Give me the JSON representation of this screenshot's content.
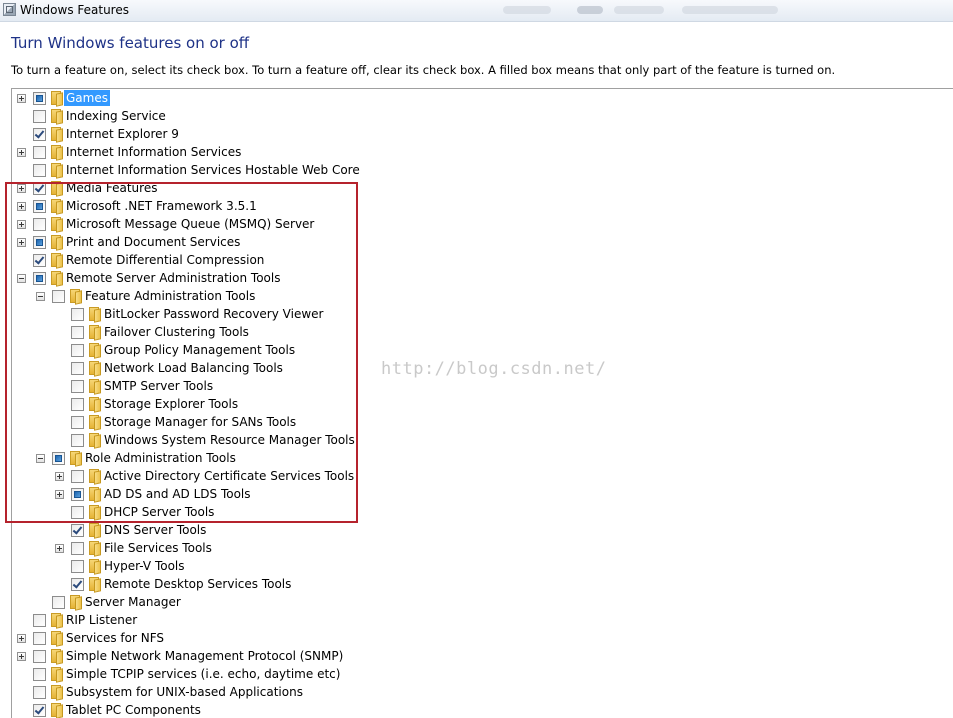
{
  "window": {
    "title": "Windows Features"
  },
  "header": {
    "title": "Turn Windows features on or off",
    "instructions": "To turn a feature on, select its check box. To turn a feature off, clear its check box. A filled box means that only part of the feature is turned on."
  },
  "watermark": "http://blog.csdn.net/",
  "tree": [
    {
      "label": "Games",
      "level": 0,
      "expander": "collapsed",
      "check": "partial",
      "selected": true
    },
    {
      "label": "Indexing Service",
      "level": 0,
      "expander": "none",
      "check": "unchecked"
    },
    {
      "label": "Internet Explorer 9",
      "level": 0,
      "expander": "none",
      "check": "checked"
    },
    {
      "label": "Internet Information Services",
      "level": 0,
      "expander": "collapsed",
      "check": "unchecked"
    },
    {
      "label": "Internet Information Services Hostable Web Core",
      "level": 0,
      "expander": "none",
      "check": "unchecked"
    },
    {
      "label": "Media Features",
      "level": 0,
      "expander": "collapsed",
      "check": "checked"
    },
    {
      "label": "Microsoft .NET Framework 3.5.1",
      "level": 0,
      "expander": "collapsed",
      "check": "partial"
    },
    {
      "label": "Microsoft Message Queue (MSMQ) Server",
      "level": 0,
      "expander": "collapsed",
      "check": "unchecked"
    },
    {
      "label": "Print and Document Services",
      "level": 0,
      "expander": "collapsed",
      "check": "partial"
    },
    {
      "label": "Remote Differential Compression",
      "level": 0,
      "expander": "none",
      "check": "checked"
    },
    {
      "label": "Remote Server Administration Tools",
      "level": 0,
      "expander": "expanded",
      "check": "partial"
    },
    {
      "label": "Feature Administration Tools",
      "level": 1,
      "expander": "expanded",
      "check": "unchecked"
    },
    {
      "label": "BitLocker Password Recovery Viewer",
      "level": 2,
      "expander": "none",
      "check": "unchecked"
    },
    {
      "label": "Failover Clustering Tools",
      "level": 2,
      "expander": "none",
      "check": "unchecked"
    },
    {
      "label": "Group Policy Management Tools",
      "level": 2,
      "expander": "none",
      "check": "unchecked"
    },
    {
      "label": "Network Load Balancing Tools",
      "level": 2,
      "expander": "none",
      "check": "unchecked"
    },
    {
      "label": "SMTP Server Tools",
      "level": 2,
      "expander": "none",
      "check": "unchecked"
    },
    {
      "label": "Storage Explorer Tools",
      "level": 2,
      "expander": "none",
      "check": "unchecked"
    },
    {
      "label": "Storage Manager for SANs Tools",
      "level": 2,
      "expander": "none",
      "check": "unchecked"
    },
    {
      "label": "Windows System Resource Manager Tools",
      "level": 2,
      "expander": "none",
      "check": "unchecked"
    },
    {
      "label": "Role Administration Tools",
      "level": 1,
      "expander": "expanded",
      "check": "partial"
    },
    {
      "label": "Active Directory Certificate Services Tools",
      "level": 2,
      "expander": "collapsed",
      "check": "unchecked"
    },
    {
      "label": "AD DS and AD LDS Tools",
      "level": 2,
      "expander": "collapsed",
      "check": "partial"
    },
    {
      "label": "DHCP Server Tools",
      "level": 2,
      "expander": "none",
      "check": "unchecked"
    },
    {
      "label": "DNS Server Tools",
      "level": 2,
      "expander": "none",
      "check": "checked"
    },
    {
      "label": "File Services Tools",
      "level": 2,
      "expander": "collapsed",
      "check": "unchecked"
    },
    {
      "label": "Hyper-V Tools",
      "level": 2,
      "expander": "none",
      "check": "unchecked"
    },
    {
      "label": "Remote Desktop Services Tools",
      "level": 2,
      "expander": "none",
      "check": "checked"
    },
    {
      "label": "Server Manager",
      "level": 1,
      "expander": "none",
      "check": "unchecked"
    },
    {
      "label": "RIP Listener",
      "level": 0,
      "expander": "none",
      "check": "unchecked"
    },
    {
      "label": "Services for NFS",
      "level": 0,
      "expander": "collapsed",
      "check": "unchecked"
    },
    {
      "label": "Simple Network Management Protocol (SNMP)",
      "level": 0,
      "expander": "collapsed",
      "check": "unchecked"
    },
    {
      "label": "Simple TCPIP services (i.e. echo, daytime etc)",
      "level": 0,
      "expander": "none",
      "check": "unchecked"
    },
    {
      "label": "Subsystem for UNIX-based Applications",
      "level": 0,
      "expander": "none",
      "check": "unchecked"
    },
    {
      "label": "Tablet PC Components",
      "level": 0,
      "expander": "none",
      "check": "checked"
    }
  ]
}
